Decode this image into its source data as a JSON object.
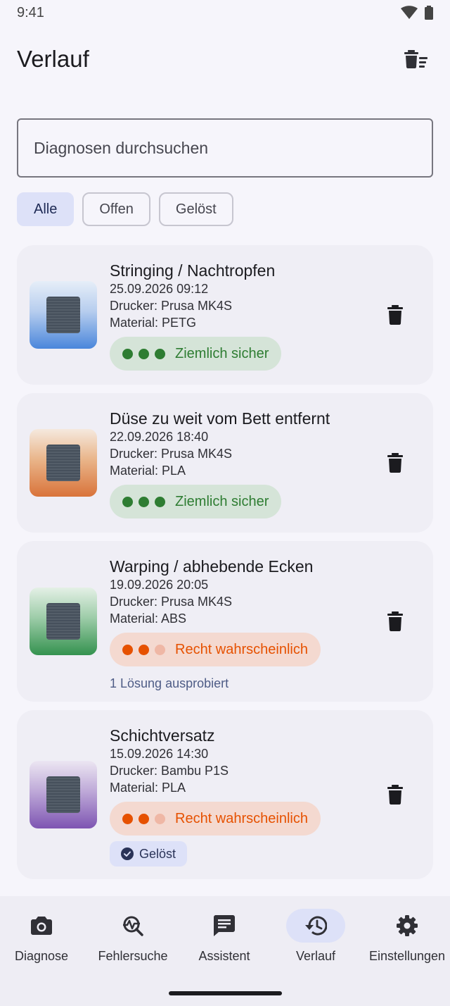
{
  "status": {
    "time": "9:41"
  },
  "header": {
    "title": "Verlauf"
  },
  "search": {
    "placeholder": "Diagnosen durchsuchen",
    "value": ""
  },
  "filters": [
    {
      "label": "Alle",
      "active": true
    },
    {
      "label": "Offen",
      "active": false
    },
    {
      "label": "Gelöst",
      "active": false
    }
  ],
  "entries": [
    {
      "title": "Stringing / Nachtropfen",
      "date": "25.09.2026 09:12",
      "printer": "Drucker: Prusa MK4S",
      "material": "Material: PETG",
      "confidence": "Ziemlich sicher",
      "confidence_level": 3,
      "thumb_color": "#4A86DB"
    },
    {
      "title": "Düse zu weit vom Bett entfernt",
      "date": "22.09.2026 18:40",
      "printer": "Drucker: Prusa MK4S",
      "material": "Material: PLA",
      "confidence": "Ziemlich sicher",
      "confidence_level": 3,
      "thumb_color": "#D9733A"
    },
    {
      "title": "Warping / abhebende Ecken",
      "date": "19.09.2026 20:05",
      "printer": "Drucker: Prusa MK4S",
      "material": "Material: ABS",
      "confidence": "Recht wahrscheinlich",
      "confidence_level": 2,
      "note": "1 Lösung ausprobiert",
      "thumb_color": "#34924F"
    },
    {
      "title": "Schichtversatz",
      "date": "15.09.2026 14:30",
      "printer": "Drucker: Bambu P1S",
      "material": "Material: PLA",
      "confidence": "Recht wahrscheinlich",
      "confidence_level": 2,
      "badge": "Gelöst",
      "thumb_color": "#7E55B2"
    }
  ],
  "nav": [
    {
      "label": "Diagnose",
      "icon": "camera-icon",
      "active": false
    },
    {
      "label": "Fehlersuche",
      "icon": "troubleshoot-icon",
      "active": false
    },
    {
      "label": "Assistent",
      "icon": "chat-icon",
      "active": false
    },
    {
      "label": "Verlauf",
      "icon": "history-icon",
      "active": true
    },
    {
      "label": "Einstellungen",
      "icon": "gear-icon",
      "active": false
    }
  ],
  "colors": {
    "background": "#F6F5FB",
    "card": "#EFEEF5",
    "accent_container": "#DDE1F8",
    "high_confidence": "#2E7D32",
    "mid_confidence": "#E65100"
  }
}
